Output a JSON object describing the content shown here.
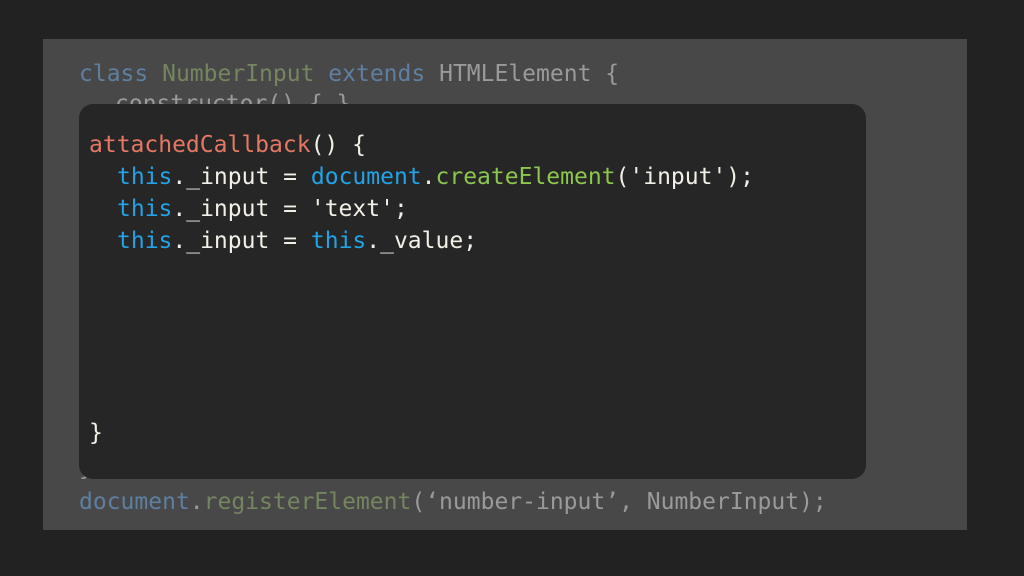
{
  "background_code": {
    "line1": {
      "class_kw": "class",
      "class_name": "NumberInput",
      "extends_kw": "extends",
      "base": "HTMLElement {"
    },
    "line2_partial": "constructor() { }",
    "closing_brace": "}",
    "register_line": {
      "obj": "document",
      "dot": ".",
      "fn": "registerElement",
      "args": "(‘number-input’, NumberInput);"
    }
  },
  "foreground_code": {
    "line1": {
      "method": "attachedCallback",
      "rest": "() {"
    },
    "line2": {
      "this": "this",
      "prop": "._input = ",
      "doc": "document",
      "dot": ".",
      "call": "createElement",
      "args": "('input');"
    },
    "line3": {
      "this": "this",
      "rest": "._input = 'text';"
    },
    "line4": {
      "this": "this",
      "prop": "._input = ",
      "this2": "this",
      "rest": "._value;"
    },
    "closing": "}"
  },
  "colors": {
    "backdrop": "#484848",
    "panel": "#262626",
    "method": "#e47865",
    "keyword_blue": "#22a3e6",
    "function_green": "#8cc64f",
    "text": "#f2efe6"
  }
}
